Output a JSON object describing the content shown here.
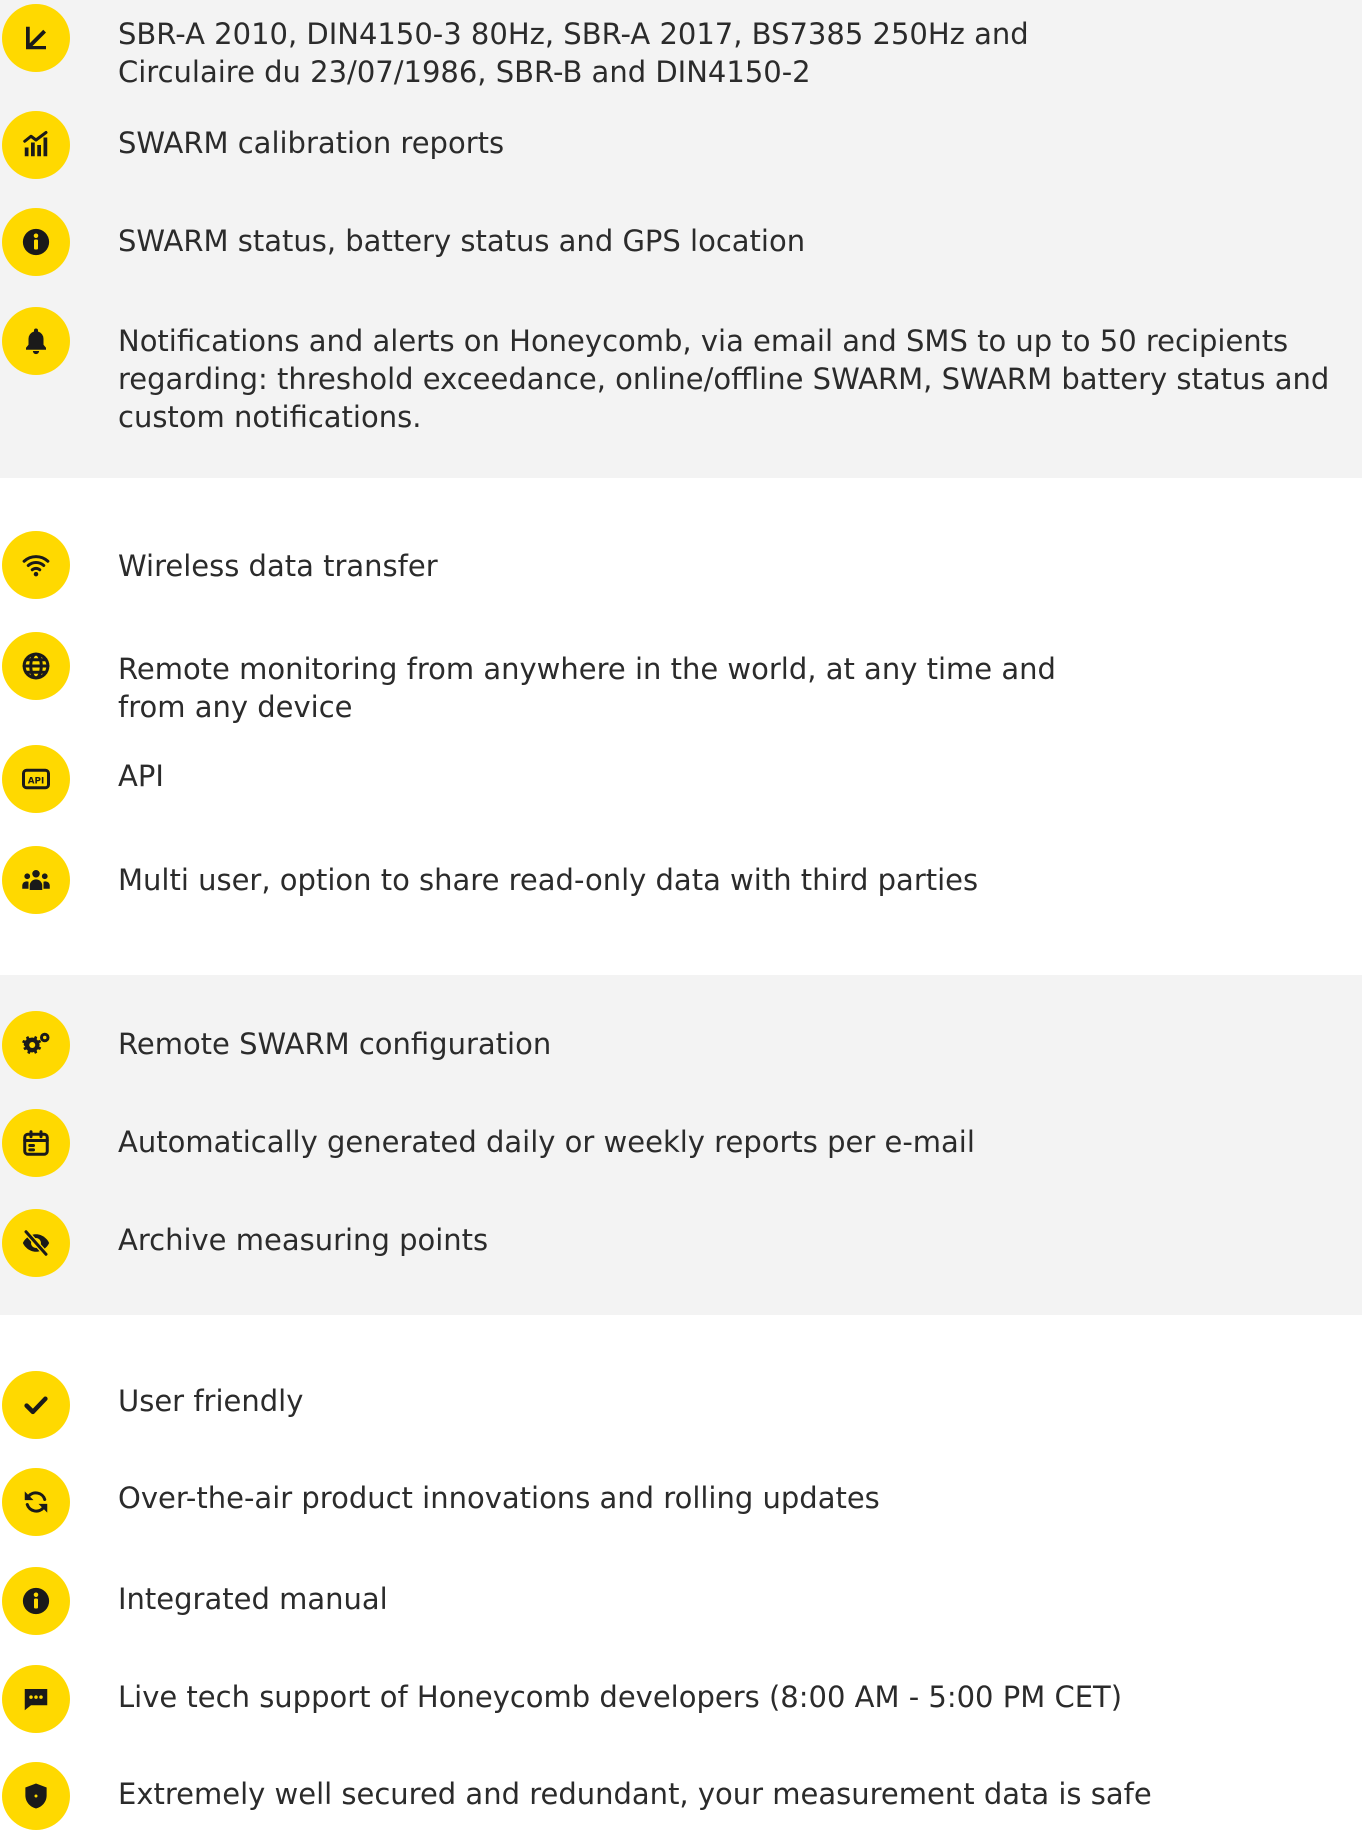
{
  "colors": {
    "accent": "#ffd900",
    "icon": "#1a1a1a",
    "band_gray": "#f3f3f3",
    "text": "#2b2b2b"
  },
  "sections": [
    {
      "items": [
        {
          "icon": "ruler-triangle-icon",
          "lines": [
            "SBR-A 2010, DIN4150-3 80Hz, SBR-A 2017, BS7385 250Hz and",
            "Circulaire du 23/07/1986, SBR-B and DIN4150-2"
          ]
        },
        {
          "icon": "chart-bars-icon",
          "lines": [
            "SWARM calibration reports"
          ]
        },
        {
          "icon": "info-icon",
          "lines": [
            "SWARM status, battery status and GPS location"
          ]
        },
        {
          "icon": "bell-icon",
          "lines": [
            "Notifications and alerts on Honeycomb, via email and SMS to up to 50 recipients",
            "regarding: threshold exceedance, online/offline SWARM, SWARM battery status and",
            "custom notifications."
          ]
        }
      ]
    },
    {
      "items": [
        {
          "icon": "wifi-icon",
          "lines": [
            "Wireless data transfer"
          ]
        },
        {
          "icon": "globe-icon",
          "lines": [
            "Remote monitoring from anywhere in the world, at any time and",
            "from any device"
          ]
        },
        {
          "icon": "api-icon",
          "lines": [
            "API"
          ]
        },
        {
          "icon": "users-icon",
          "lines": [
            "Multi user, option to share read-only data with third parties"
          ]
        }
      ]
    },
    {
      "items": [
        {
          "icon": "gears-icon",
          "lines": [
            "Remote SWARM configuration"
          ]
        },
        {
          "icon": "calendar-icon",
          "lines": [
            "Automatically generated daily or weekly reports per e-mail"
          ]
        },
        {
          "icon": "eye-slash-icon",
          "lines": [
            "Archive measuring points"
          ]
        }
      ]
    },
    {
      "items": [
        {
          "icon": "check-icon",
          "lines": [
            "User friendly"
          ]
        },
        {
          "icon": "sync-icon",
          "lines": [
            "Over-the-air product innovations and rolling updates"
          ]
        },
        {
          "icon": "info-icon",
          "lines": [
            "Integrated manual"
          ]
        },
        {
          "icon": "chat-icon",
          "lines": [
            "Live tech support of Honeycomb developers (8:00 AM - 5:00 PM CET)"
          ]
        },
        {
          "icon": "shield-icon",
          "lines": [
            "Extremely well secured and redundant, your measurement data is safe"
          ]
        }
      ]
    }
  ]
}
